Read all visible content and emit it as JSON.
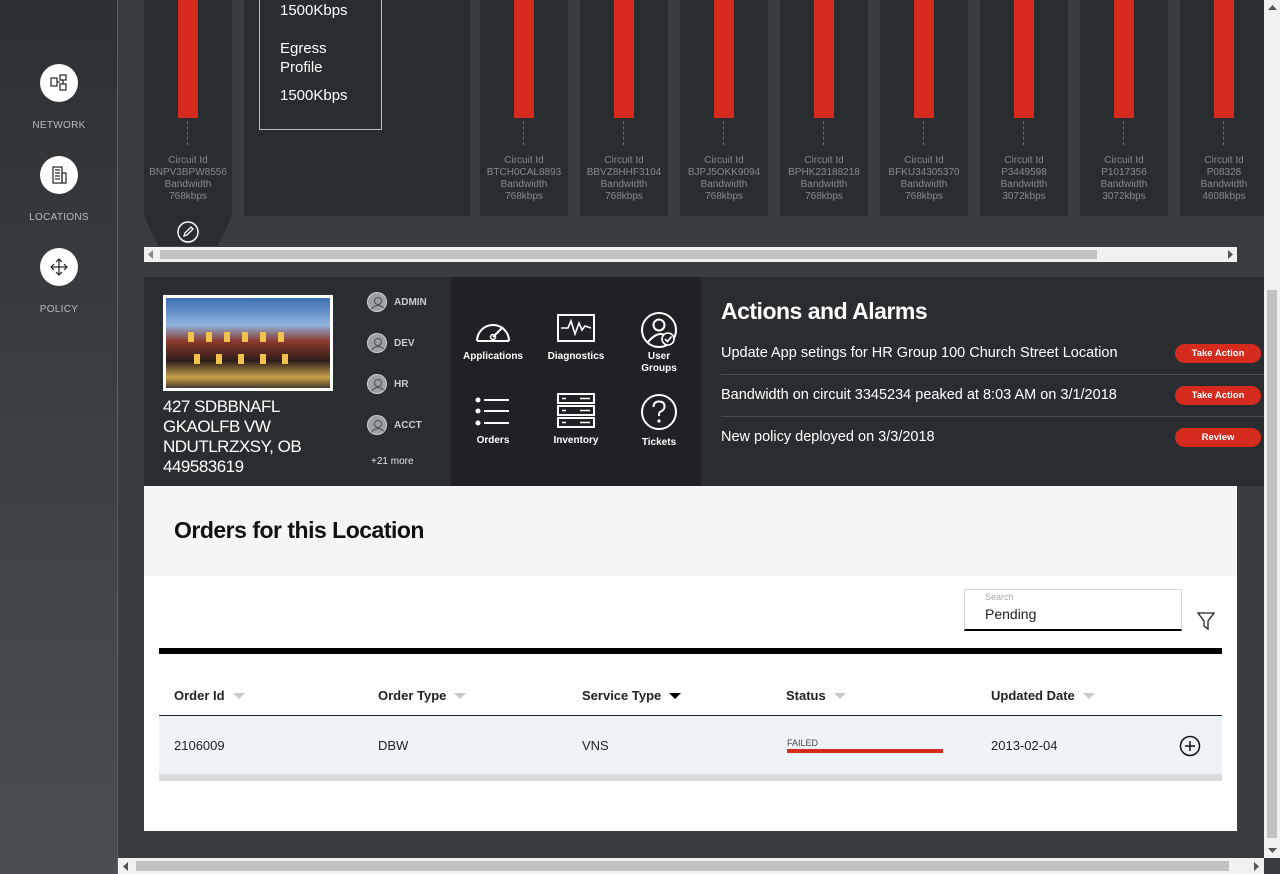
{
  "sidebar": {
    "items": [
      {
        "label": "NETWORK",
        "icon": "network-icon"
      },
      {
        "label": "LOCATIONS",
        "icon": "building-icon"
      },
      {
        "label": "POLICY",
        "icon": "move-arrows-icon"
      }
    ]
  },
  "circuits": {
    "id_label": "Circuit Id",
    "bandwidth_label": "Bandwidth",
    "items": [
      {
        "id": "BNPV3BPW8556",
        "bandwidth": "768kbps"
      },
      {
        "id": "BTCH0CAL8893",
        "bandwidth": "768kbps"
      },
      {
        "id": "BBVZ8HHF3104",
        "bandwidth": "768kbps"
      },
      {
        "id": "BJPJ5OKK9094",
        "bandwidth": "768kbps"
      },
      {
        "id": "BPHK23188218",
        "bandwidth": "768kbps"
      },
      {
        "id": "BFKU34305370",
        "bandwidth": "768kbps"
      },
      {
        "id": "P3449598",
        "bandwidth": "3072kbps"
      },
      {
        "id": "P1017356",
        "bandwidth": "3072kbps"
      },
      {
        "id": "P08328",
        "bandwidth": "4608kbps"
      }
    ],
    "profile": {
      "ingress_value": "1500Kbps",
      "egress_label": "Egress Profile",
      "egress_value": "1500Kbps"
    }
  },
  "location": {
    "address_line1": "427 SDBBNAFL",
    "address_line2": "GKAOLFB VW",
    "address_line3": "NDUTLRZXSY, OB",
    "address_line4": "449583619",
    "groups": [
      "ADMIN",
      "DEV",
      "HR",
      "ACCT"
    ],
    "more": "+21 more"
  },
  "tools": [
    {
      "label": "Applications",
      "icon": "speedometer-icon"
    },
    {
      "label": "Diagnostics",
      "icon": "pulse-icon"
    },
    {
      "label": "User Groups",
      "icon": "user-check-icon"
    },
    {
      "label": "Orders",
      "icon": "list-icon"
    },
    {
      "label": "Inventory",
      "icon": "server-icon"
    },
    {
      "label": "Tickets",
      "icon": "question-icon"
    }
  ],
  "actions": {
    "title": "Actions and Alarms",
    "alarms": [
      {
        "text": "Update App setings for HR Group 100 Church Street Location",
        "button": "Take Action"
      },
      {
        "text": "Bandwidth on circuit 3345234 peaked at 8:03 AM on 3/1/2018",
        "button": "Take Action"
      },
      {
        "text": "New policy deployed on 3/3/2018",
        "button": "Review"
      }
    ]
  },
  "orders": {
    "title": "Orders for this Location",
    "search": {
      "label": "Search",
      "value": "Pending"
    },
    "columns": [
      "Order Id",
      "Order Type",
      "Service Type",
      "Status",
      "Updated Date"
    ],
    "sorted_column": "Service Type",
    "rows": [
      {
        "order_id": "2106009",
        "order_type": "DBW",
        "service_type": "VNS",
        "status": "FAILED",
        "updated_date": "2013-02-04"
      }
    ]
  },
  "colors": {
    "accent": "#d52b1e",
    "panel_dark": "#2a2d30",
    "panel_darker": "#1f2124",
    "background": "#3a3d40"
  }
}
